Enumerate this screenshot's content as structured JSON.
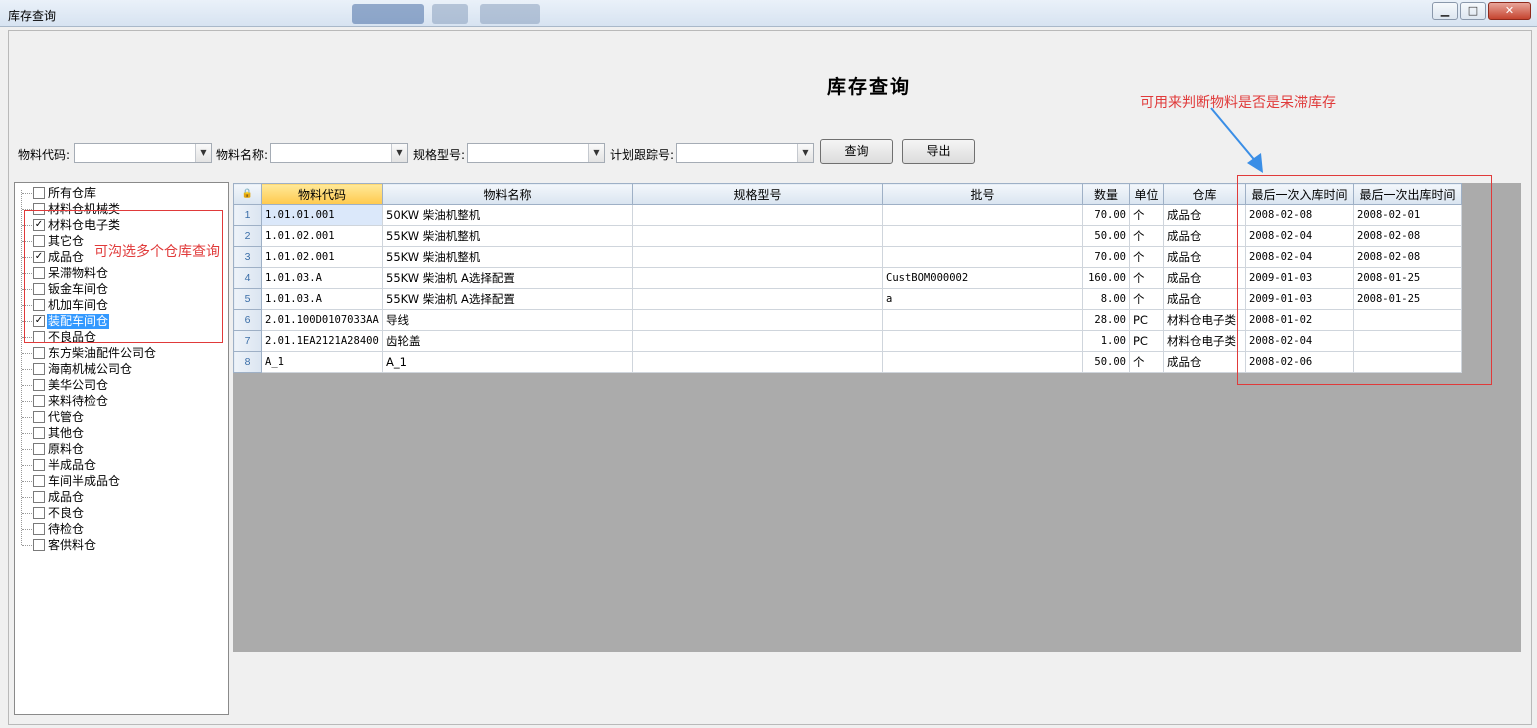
{
  "window": {
    "title": "库存查询",
    "min": "▁",
    "max": "□",
    "close": "✕"
  },
  "page": {
    "title": "库存查询"
  },
  "filters": {
    "material_code_label": "物料代码:",
    "material_name_label": "物料名称:",
    "spec_label": "规格型号:",
    "plan_track_label": "计划跟踪号:",
    "material_code_value": "",
    "material_name_value": "",
    "spec_value": "",
    "plan_track_value": "",
    "query_button": "查询",
    "export_button": "导出"
  },
  "tree": {
    "items": [
      {
        "label": "所有仓库",
        "checked": false
      },
      {
        "label": "材料仓机械类",
        "checked": false
      },
      {
        "label": "材料仓电子类",
        "checked": true
      },
      {
        "label": "其它仓",
        "checked": false
      },
      {
        "label": "成品仓",
        "checked": true
      },
      {
        "label": "呆滞物料仓",
        "checked": false
      },
      {
        "label": "钣金车间仓",
        "checked": false
      },
      {
        "label": "机加车间仓",
        "checked": false
      },
      {
        "label": "装配车间仓",
        "checked": true,
        "selected": true
      },
      {
        "label": "不良品仓",
        "checked": false
      },
      {
        "label": "东方柴油配件公司仓",
        "checked": false
      },
      {
        "label": "海南机械公司仓",
        "checked": false
      },
      {
        "label": "美华公司仓",
        "checked": false
      },
      {
        "label": "来料待检仓",
        "checked": false
      },
      {
        "label": "代管仓",
        "checked": false
      },
      {
        "label": "其他仓",
        "checked": false
      },
      {
        "label": "原料仓",
        "checked": false
      },
      {
        "label": "半成品仓",
        "checked": false
      },
      {
        "label": "车间半成品仓",
        "checked": false
      },
      {
        "label": "成品仓",
        "checked": false
      },
      {
        "label": "不良仓",
        "checked": false
      },
      {
        "label": "待检仓",
        "checked": false
      },
      {
        "label": "客供料仓",
        "checked": false
      }
    ]
  },
  "grid": {
    "corner_icon": "lock-icon",
    "columns": [
      "物料代码",
      "物料名称",
      "规格型号",
      "批号",
      "数量",
      "单位",
      "仓库",
      "最后一次入库时间",
      "最后一次出库时间"
    ],
    "rows": [
      [
        "1",
        "1.01.01.001",
        "50KW 柴油机整机",
        "",
        "",
        "70.00",
        "个",
        "成品仓",
        "2008-02-08",
        "2008-02-01"
      ],
      [
        "2",
        "1.01.02.001",
        "55KW 柴油机整机",
        "",
        "",
        "50.00",
        "个",
        "成品仓",
        "2008-02-04",
        "2008-02-08"
      ],
      [
        "3",
        "1.01.02.001",
        "55KW 柴油机整机",
        "",
        "",
        "70.00",
        "个",
        "成品仓",
        "2008-02-04",
        "2008-02-08"
      ],
      [
        "4",
        "1.01.03.A",
        "55KW 柴油机  A选择配置",
        "",
        "CustBOM000002",
        "160.00",
        "个",
        "成品仓",
        "2009-01-03",
        "2008-01-25"
      ],
      [
        "5",
        "1.01.03.A",
        "55KW 柴油机  A选择配置",
        "",
        "a",
        "8.00",
        "个",
        "成品仓",
        "2009-01-03",
        "2008-01-25"
      ],
      [
        "6",
        "2.01.100D0107033AA",
        "导线",
        "",
        "",
        "28.00",
        "PC",
        "材料仓电子类",
        "2008-01-02",
        ""
      ],
      [
        "7",
        "2.01.1EA2121A28400",
        "齿轮盖",
        "",
        "",
        "1.00",
        "PC",
        "材料仓电子类",
        "2008-02-04",
        ""
      ],
      [
        "8",
        "A_1",
        "A_1",
        "",
        "",
        "50.00",
        "个",
        "成品仓",
        "2008-02-06",
        ""
      ]
    ]
  },
  "annotations": {
    "multi_select_note": "可沟选多个仓库查询",
    "stagnant_note": "可用来判断物料是否是呆滞库存",
    "color": "#e03a3a",
    "arrow_color": "#3a8ee6"
  }
}
